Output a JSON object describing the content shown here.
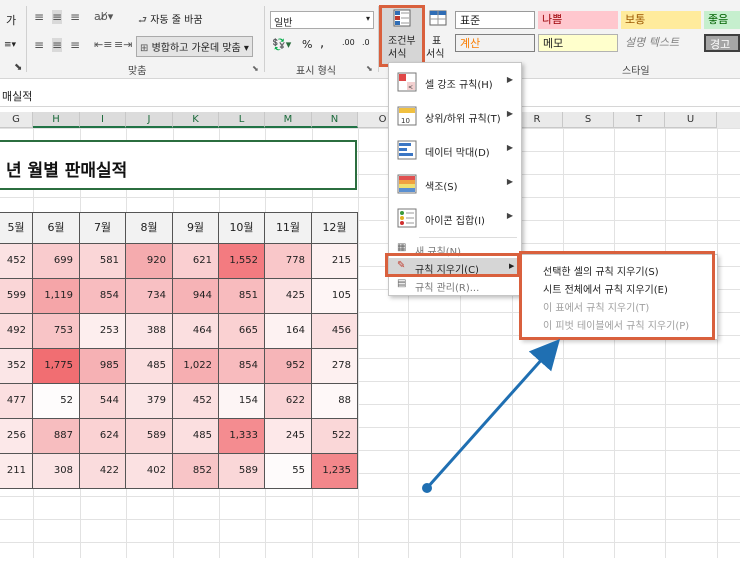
{
  "ribbon": {
    "wrap_text": "자동 줄 바꿈",
    "merge_center": "병합하고 가운데 맞춤",
    "number_format": "일반",
    "percent": "%",
    "comma": ",",
    "decimal_inc": ".00",
    "decimal_dec": ".0",
    "cond_format_line1": "조건부",
    "cond_format_line2": "서식",
    "table_format_line1": "표",
    "table_format_line2": "서식",
    "group_alignment": "맞춤",
    "group_number": "표시 형식",
    "group_styles": "스타일",
    "styles": [
      "표준",
      "나쁨",
      "보통",
      "좋음",
      "계산",
      "메모",
      "설명 텍스트",
      "경고"
    ],
    "left_letter": "가"
  },
  "formula_bar": {
    "text": "매실적"
  },
  "columns": [
    "G",
    "H",
    "I",
    "J",
    "K",
    "L",
    "M",
    "N",
    "O",
    "P",
    "Q",
    "R",
    "S",
    "T",
    "U"
  ],
  "sheet": {
    "title": "년 월별 판매실적",
    "headers": [
      "5월",
      "6월",
      "7월",
      "8월",
      "9월",
      "10월",
      "11월",
      "12월"
    ],
    "rows": [
      [
        "452",
        "699",
        "581",
        "920",
        "621",
        "1,552",
        "778",
        "215"
      ],
      [
        "599",
        "1,119",
        "854",
        "734",
        "944",
        "851",
        "425",
        "105"
      ],
      [
        "492",
        "753",
        "253",
        "388",
        "464",
        "665",
        "164",
        "456"
      ],
      [
        "352",
        "1,775",
        "985",
        "485",
        "1,022",
        "854",
        "952",
        "278"
      ],
      [
        "477",
        "52",
        "544",
        "379",
        "452",
        "154",
        "622",
        "88"
      ],
      [
        "256",
        "887",
        "624",
        "589",
        "485",
        "1,333",
        "245",
        "522"
      ],
      [
        "211",
        "308",
        "422",
        "402",
        "852",
        "589",
        "55",
        "1,235"
      ]
    ],
    "fills": [
      [
        "#fbe2e3",
        "#f9cbcd",
        "#fad6d7",
        "#f5abae",
        "#facfd1",
        "#f37b80",
        "#f9c7c9",
        "#fdf1f1"
      ],
      [
        "#fad6d7",
        "#f5a5a8",
        "#f8bcbf",
        "#f8c0c3",
        "#f6b3b6",
        "#f8bbbe",
        "#fbe0e1",
        "#fef5f5"
      ],
      [
        "#fbdcdd",
        "#f8c4c6",
        "#fdeeee",
        "#fbe5e6",
        "#fbdfe0",
        "#fad1d2",
        "#fdf2f2",
        "#fbe0e1"
      ],
      [
        "#fbe6e7",
        "#f16e72",
        "#f6b1b4",
        "#fbdfe0",
        "#f6aeb1",
        "#f8bbbe",
        "#f6b5b8",
        "#fdf0f0"
      ],
      [
        "#fbdfe0",
        "#fefcfc",
        "#fad7d8",
        "#fbe6e7",
        "#fbdfe0",
        "#fdf5f5",
        "#fad3d5",
        "#fef8f8"
      ],
      [
        "#fce8e9",
        "#f7bdbf",
        "#fad2d3",
        "#fad7d8",
        "#fbdfe0",
        "#f48c90",
        "#fde8e9",
        "#fad7d8"
      ],
      [
        "#fcebeb",
        "#fbe4e5",
        "#fadcdd",
        "#fbe1e2",
        "#f8c5c7",
        "#fad7d8",
        "#fefbfb",
        "#f3878b"
      ]
    ]
  },
  "cf_menu": {
    "items": [
      {
        "label": "셀 강조 규칙(H)",
        "icon": "highlight-cells-icon",
        "arrow": true
      },
      {
        "label": "상위/하위 규칙(T)",
        "icon": "top-bottom-icon",
        "arrow": true
      },
      {
        "label": "데이터 막대(D)",
        "icon": "data-bars-icon",
        "arrow": true
      },
      {
        "label": "색조(S)",
        "icon": "color-scales-icon",
        "arrow": true
      },
      {
        "label": "아이콘 집합(I)",
        "icon": "icon-sets-icon",
        "arrow": true
      }
    ],
    "new_rule": "새 규칙(N)...",
    "clear_rules": "규칙 지우기(C)",
    "manage_rules": "규칙 관리(R)..."
  },
  "clear_submenu": {
    "items": [
      {
        "label": "선택한 셀의 규칙 지우기(S)",
        "enabled": true
      },
      {
        "label": "시트 전체에서 규칙 지우기(E)",
        "enabled": true
      },
      {
        "label": "이 표에서 규칙 지우기(T)",
        "enabled": false
      },
      {
        "label": "이 피벗 테이블에서 규칙 지우기(P)",
        "enabled": false
      }
    ]
  },
  "colors": {
    "highlight": "#d9603d",
    "arrow": "#1f6fb2",
    "excel_green": "#217346"
  }
}
